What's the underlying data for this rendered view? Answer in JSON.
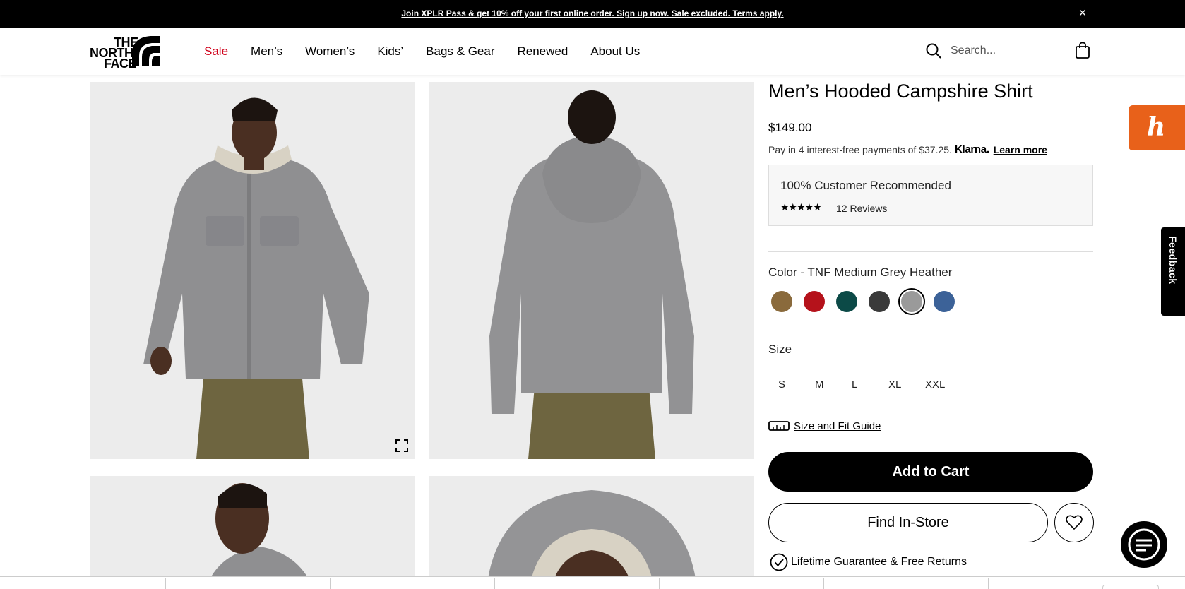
{
  "promo": {
    "text": "Join XPLR Pass & get 10% off your first online order. Sign up now. Sale excluded. Terms apply.",
    "close_icon": "close-icon"
  },
  "header": {
    "logo_lines": [
      "THE",
      "NORTH",
      "FACE"
    ],
    "nav": [
      "Sale",
      "Men’s",
      "Women’s",
      "Kids’",
      "Bags & Gear",
      "Renewed",
      "About Us"
    ],
    "search_placeholder": "Search...",
    "search_icon": "search-icon",
    "bag_icon": "shopping-bag-icon"
  },
  "product": {
    "title": "Men’s Hooded Campshire Shirt",
    "price": "$149.00",
    "klarna_text": "Pay in 4 interest-free payments of $37.25.",
    "klarna_logo": "Klarna.",
    "klarna_learn": "Learn more",
    "recommended": "100% Customer Recommended",
    "rating_stars": "★★★★★",
    "rating": 5,
    "reviews": "12 Reviews",
    "color_label": "Color - TNF Medium Grey Heather",
    "colors": [
      {
        "name": "brown",
        "hex": "#8a6a3c",
        "selected": false
      },
      {
        "name": "red",
        "hex": "#b5121b",
        "selected": false
      },
      {
        "name": "dark-teal",
        "hex": "#0c4a47",
        "selected": false
      },
      {
        "name": "dark-grey",
        "hex": "#3a3a3a",
        "selected": false
      },
      {
        "name": "tnf-medium-grey-heather",
        "hex": "#9a9a9a",
        "selected": true
      },
      {
        "name": "blue",
        "hex": "#3c6298",
        "selected": false
      }
    ],
    "size_label": "Size",
    "sizes": [
      "S",
      "M",
      "L",
      "XL",
      "XXL"
    ],
    "size_guide": "Size and Fit Guide",
    "add_to_cart": "Add to Cart",
    "find_in_store": "Find In-Store",
    "guarantee": "Lifetime Guarantee & Free Returns"
  },
  "widgets": {
    "honey_letter": "h",
    "feedback": "Feedback"
  },
  "colors": {
    "sale": "#d0021b",
    "promo_bg": "#000000",
    "honey": "#e8611a"
  }
}
